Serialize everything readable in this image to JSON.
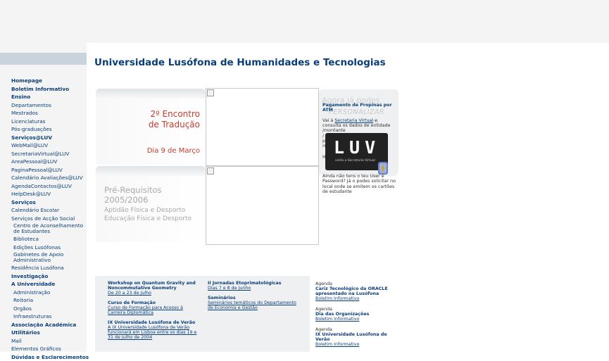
{
  "header": {
    "title": "Universidade Lusófona de Humanidades e Tecnologias"
  },
  "nav": [
    {
      "label": "Homepage",
      "bold": true
    },
    {
      "label": "Boletim Informativo",
      "bold": true
    },
    {
      "label": "Ensino",
      "bold": true
    },
    {
      "label": "Departamentos"
    },
    {
      "label": "Mestrados"
    },
    {
      "label": "Licenciaturas"
    },
    {
      "label": "Pós-graduações"
    },
    {
      "label": "Serviços@LUV",
      "bold": true
    },
    {
      "label": "WebMail@LUV"
    },
    {
      "label": "SecretariaVirtual@LUV"
    },
    {
      "label": "AreaPessoal@LUV"
    },
    {
      "label": "PaginaPessoal@LUV"
    },
    {
      "label": "Calendário Avaliações@LUV"
    },
    {
      "label": "AgendaContactos@LUV"
    },
    {
      "label": "HelpDesk@LUV"
    },
    {
      "label": "Serviços",
      "bold": true
    },
    {
      "label": "Calendário Escolar"
    },
    {
      "label": "Serviços de Acção Social"
    },
    {
      "label": "Centro de Aconselhamento de Estudantes",
      "sub": true,
      "wrap": true
    },
    {
      "label": "Biblioteca",
      "sub": true
    },
    {
      "label": "Edições Lusófonas",
      "sub": true
    },
    {
      "label": "Gabinetes de Apoio Administrativo",
      "sub": true,
      "wrap": true
    },
    {
      "label": "Residência Lusófona"
    },
    {
      "label": "Investigação",
      "bold": true
    },
    {
      "label": "A Universidade",
      "bold": true
    },
    {
      "label": "Administração",
      "sub": true
    },
    {
      "label": "Reitoria",
      "sub": true
    },
    {
      "label": "Orgãos",
      "sub": true
    },
    {
      "label": "Infraestruturas",
      "sub": true
    },
    {
      "label": "Associação Académica",
      "bold": true
    },
    {
      "label": "Utilitários",
      "bold": true
    },
    {
      "label": "Mail"
    },
    {
      "label": "Elementos Gráficos"
    },
    {
      "label": "Dúvidas e Esclarecimentos",
      "bold": true
    }
  ],
  "banners": {
    "encontro": {
      "line1": "2º Encontro",
      "line2": "de Tradução",
      "date": "Dia 9 de Março"
    },
    "prereq": {
      "line1": "Pré-Requisitos",
      "line2": "2005/2006",
      "line3": "Aptidão Física e Desporto",
      "line4": "Educação Física e Desporto"
    }
  },
  "propinas": {
    "ghost1": "Agora já podes",
    "ghost2": "PERSONALIZAR",
    "ghost3": "ord",
    "title": "Pagamento de Propinas por ATM",
    "text_before": "Vai à ",
    "link": "Secretaria Virtual",
    "text_after": " e consulta os dados de entidade /montante",
    "line3": "/",
    "line4": "p",
    "line5": "re",
    "line6": "H",
    "under": "Ainda não tens o teu User e Password? Já o podes solicitar no local onde se emitem os cartões de estudante",
    "luv": "LUV",
    "luv_sub": "visita a Secretaria Virtual"
  },
  "news_left": [
    {
      "title": "Workshop on Quantum Gravity and Noncommutative Geometry",
      "link": "De 20 a 23 de Julho"
    },
    {
      "title": "Curso de Formação",
      "link": "Curso de Formação para Acesso à Carreira Diplomática"
    },
    {
      "title": "IX Universidade Lusófona de Verão",
      "link": "A IX Universidade Lusófona de Verão funcionará em Lisboa entre os dias 19 e 31 de Julho de 2004"
    }
  ],
  "news_right": [
    {
      "title": "II Jornadas Etoprimatológicas",
      "link": "Dias 7 e 8 de Junho"
    },
    {
      "title": "Seminários",
      "link": "Seminários temáticos do Departamento de Economia e Gestão"
    }
  ],
  "agenda": [
    {
      "label": "Agenda",
      "title": "Cariz Tecnológico da ORACLE apresentado na Lusófona",
      "link": "Boletim Informativo"
    },
    {
      "label": "Agenda",
      "title": "Dia das Organizações",
      "link": "Boletim Informativo"
    },
    {
      "label": "Agenda",
      "title": "IX Universidade Lusófona de Verão",
      "link": "Boletim Informativo"
    }
  ]
}
